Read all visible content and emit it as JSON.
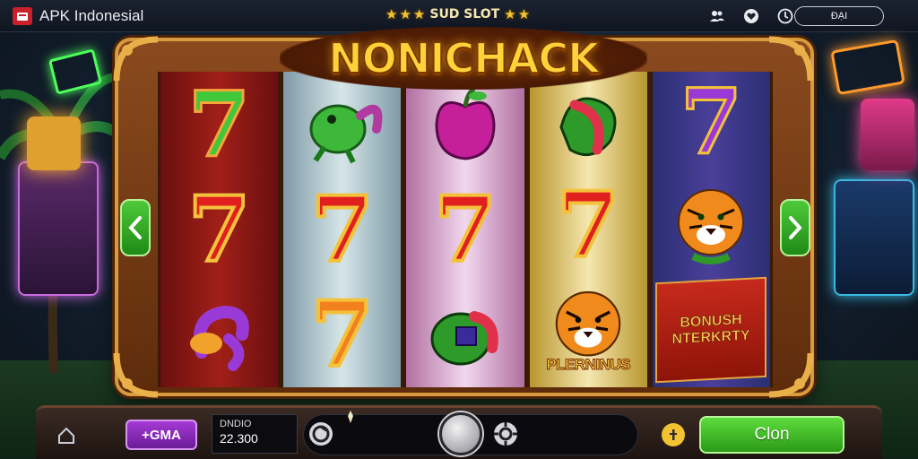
{
  "app": {
    "title": "APK Indonesial",
    "logo_icon": "app-logo-icon"
  },
  "topbar": {
    "slot_label": "SUD SLOT",
    "icons": [
      "users-icon",
      "heart-icon",
      "clock-icon"
    ],
    "button_label": "ĐẠI"
  },
  "game": {
    "title": "NONICHACK",
    "reels": [
      [
        "seven-green",
        "seven-red",
        "candy-purple"
      ],
      [
        "frog-green",
        "seven-red",
        "seven-orange"
      ],
      [
        "apple-purple",
        "seven-red",
        "fruit-green"
      ],
      [
        "fruit-green",
        "seven-red",
        "tiger-plerninus"
      ],
      [
        "seven-purple",
        "tiger",
        "bonus-banner"
      ]
    ],
    "tiger_caption": "PLERNINUS",
    "bonus_lines": [
      "BONUSH",
      "NTERKRTY"
    ]
  },
  "controls": {
    "home_icon": "home-icon",
    "purple_button_label": "+GMA",
    "balance_label": "DNDIO",
    "balance_value": "22.300",
    "green_button_label": "Clon",
    "info_icon": "info-icon"
  },
  "colors": {
    "frame": "#8a4a1e",
    "title": "#ffd23a",
    "spin_green": "#3fbf28",
    "purple": "#8a2ab8"
  }
}
